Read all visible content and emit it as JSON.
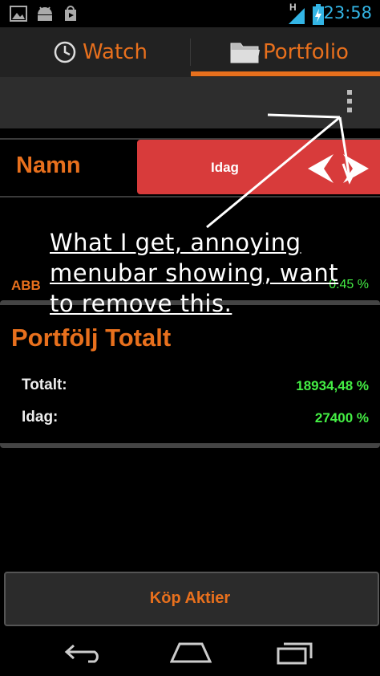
{
  "status_bar": {
    "time": "23:58",
    "network": "H",
    "icons": [
      "gallery-icon",
      "android-icon",
      "play-store-icon",
      "signal-icon",
      "battery-charging-icon"
    ]
  },
  "tabs": [
    {
      "label": "Watch",
      "icon": "clock-icon",
      "selected": false
    },
    {
      "label": "Portfolio",
      "icon": "folder-icon",
      "selected": true
    }
  ],
  "accent_color": "#e8701d",
  "positive_color": "#44ee44",
  "header": {
    "name_label": "Namn",
    "column_label": "Idag",
    "panel_color": "#d83b3b"
  },
  "stocks": [
    {
      "name": "ABB",
      "change": "0.45 %"
    }
  ],
  "totals": {
    "title": "Portfölj Totalt",
    "rows": [
      {
        "label": "Totalt:",
        "value": "18934,48 %"
      },
      {
        "label": "Idag:",
        "value": "27400 %"
      }
    ]
  },
  "buy_button": {
    "label": "Köp Aktier"
  },
  "annotation": {
    "text": "What I get, annoying menubar showing, want to remove this."
  }
}
